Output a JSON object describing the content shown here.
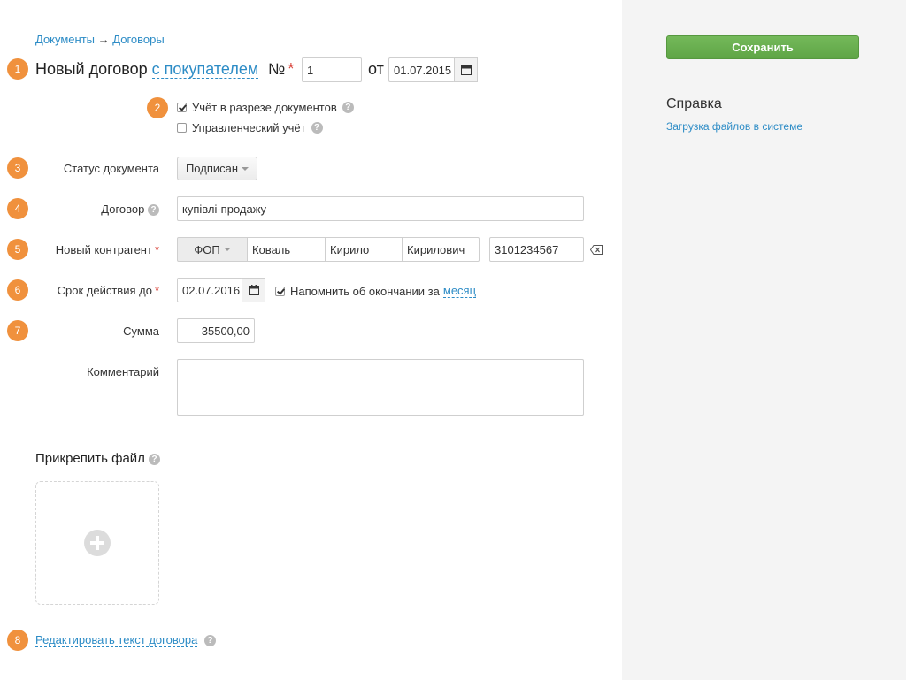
{
  "breadcrumb": {
    "documents": "Документы",
    "arrow": "→",
    "contracts": "Договоры"
  },
  "title": {
    "prefix": "Новый договор",
    "type_link": "с покупателем",
    "number_sign": "№",
    "number_value": "1",
    "from": "от",
    "date": "01.07.2015"
  },
  "checkboxes": {
    "by_documents": {
      "label": "Учёт в разрезе документов",
      "checked": true
    },
    "management": {
      "label": "Управленческий учёт",
      "checked": false
    }
  },
  "status": {
    "label": "Статус документа",
    "value": "Подписан"
  },
  "contract": {
    "label": "Договор",
    "value": "купівлі-продажу"
  },
  "counterparty": {
    "label": "Новый контрагент",
    "type": "ФОП",
    "last_name": "Коваль",
    "first_name": "Кирило",
    "patronymic": "Кирилович",
    "code": "3101234567"
  },
  "validity": {
    "label": "Срок действия до",
    "date": "02.07.2016",
    "remind_label": "Напомнить об окончании за",
    "remind_period": "месяц",
    "remind_checked": true
  },
  "amount": {
    "label": "Сумма",
    "value": "35500,00"
  },
  "comment": {
    "label": "Комментарий",
    "value": ""
  },
  "attach": {
    "label": "Прикрепить файл"
  },
  "edit_text_link": "Редактировать текст договора",
  "steps": [
    "1",
    "2",
    "3",
    "4",
    "5",
    "6",
    "7",
    "8"
  ],
  "sidebar": {
    "save_label": "Сохранить",
    "help_title": "Справка",
    "help_link": "Загрузка файлов в системе"
  },
  "icons": {
    "help": "?",
    "calendar": "calendar-icon",
    "clear": "backspace-icon",
    "add": "plus-circle-icon"
  },
  "colors": {
    "accent": "#2d8cc6",
    "badge": "#f0913d",
    "save": "#66aa4e",
    "required": "#d9453c"
  }
}
